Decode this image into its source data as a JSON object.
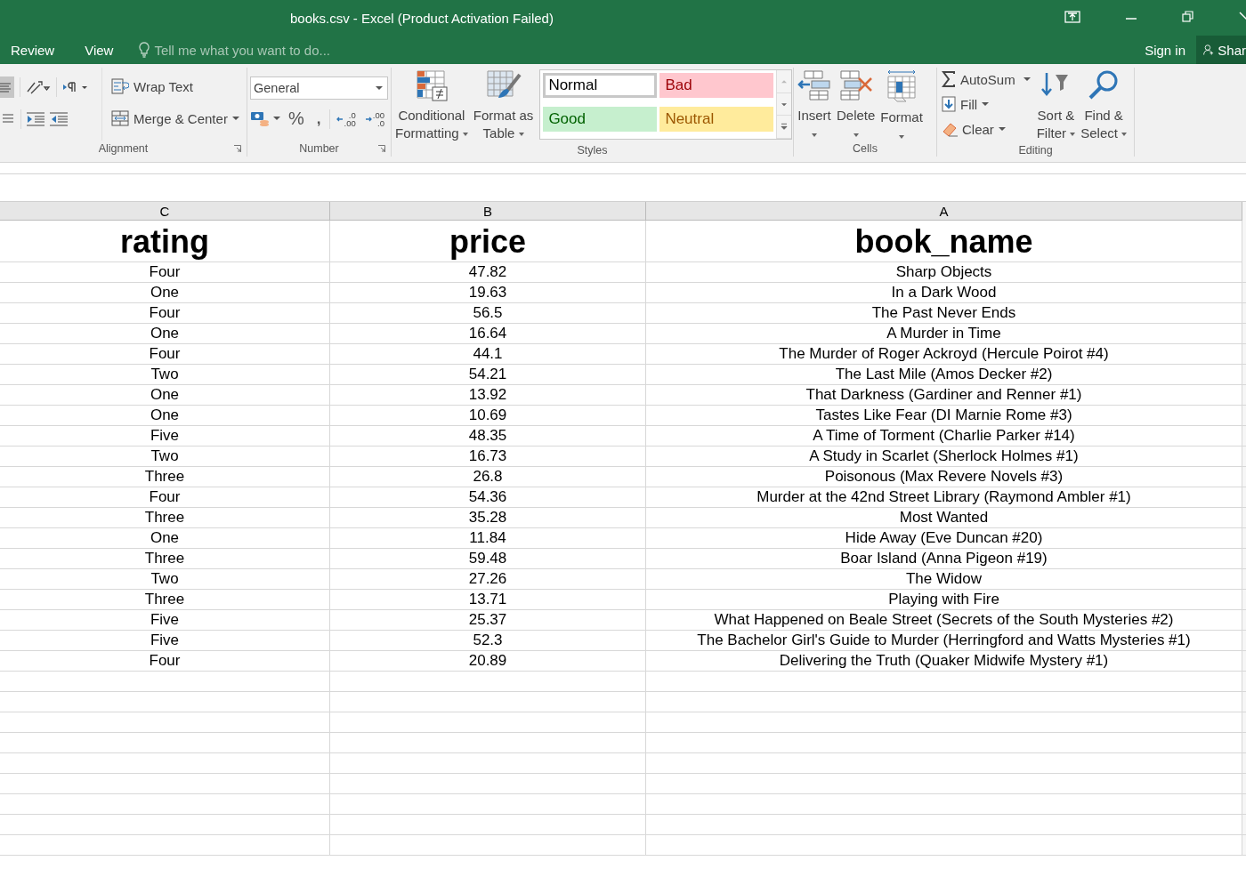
{
  "window": {
    "title": "books.csv - Excel (Product Activation Failed)"
  },
  "tabs": [
    {
      "label": "Review"
    },
    {
      "label": "View"
    }
  ],
  "tell_me": {
    "placeholder": "Tell me what you want to do..."
  },
  "account": {
    "sign_in": "Sign in",
    "share": "Shar"
  },
  "ribbon": {
    "alignment": {
      "label": "Alignment",
      "wrap_text": "Wrap Text",
      "merge": "Merge & Center"
    },
    "number": {
      "label": "Number",
      "format": "General",
      "percent": "%",
      "comma": ",",
      "increase_decimal": [
        ".0",
        ".00"
      ],
      "decrease_decimal": [
        ".00",
        ".0"
      ]
    },
    "styles": {
      "label": "Styles",
      "conditional": [
        "Conditional",
        "Formatting"
      ],
      "format_table": [
        "Format as",
        "Table"
      ],
      "cells": [
        {
          "label": "Normal",
          "kind": "normal",
          "selected": true
        },
        {
          "label": "Bad",
          "kind": "bad",
          "selected": false
        },
        {
          "label": "Good",
          "kind": "good",
          "selected": false
        },
        {
          "label": "Neutral",
          "kind": "neutral",
          "selected": false
        }
      ]
    },
    "cells": {
      "label": "Cells",
      "buttons": [
        {
          "label": "Insert",
          "kind": "insert"
        },
        {
          "label": "Delete",
          "kind": "delete"
        },
        {
          "label": "Format",
          "kind": "format"
        }
      ]
    },
    "editing": {
      "label": "Editing",
      "autosum": "AutoSum",
      "fill": "Fill",
      "clear": "Clear",
      "sort": [
        "Sort &",
        "Filter"
      ],
      "find": [
        "Find &",
        "Select"
      ]
    }
  },
  "sheet": {
    "columns": [
      "C",
      "B",
      "A"
    ],
    "header": [
      "rating",
      "price",
      "book_name"
    ],
    "rows": [
      [
        "Four",
        "47.82",
        "Sharp Objects"
      ],
      [
        "One",
        "19.63",
        "In a Dark Wood"
      ],
      [
        "Four",
        "56.5",
        "The Past Never Ends"
      ],
      [
        "One",
        "16.64",
        "A Murder in Time"
      ],
      [
        "Four",
        "44.1",
        "The Murder of Roger Ackroyd (Hercule Poirot #4)"
      ],
      [
        "Two",
        "54.21",
        "The Last Mile (Amos Decker #2)"
      ],
      [
        "One",
        "13.92",
        "That Darkness (Gardiner and Renner #1)"
      ],
      [
        "One",
        "10.69",
        "Tastes Like Fear (DI Marnie Rome #3)"
      ],
      [
        "Five",
        "48.35",
        "A Time of Torment (Charlie Parker #14)"
      ],
      [
        "Two",
        "16.73",
        "A Study in Scarlet (Sherlock Holmes #1)"
      ],
      [
        "Three",
        "26.8",
        "Poisonous (Max Revere Novels #3)"
      ],
      [
        "Four",
        "54.36",
        "Murder at the 42nd Street Library (Raymond Ambler #1)"
      ],
      [
        "Three",
        "35.28",
        "Most Wanted"
      ],
      [
        "One",
        "11.84",
        "Hide Away (Eve Duncan #20)"
      ],
      [
        "Three",
        "59.48",
        "Boar Island (Anna Pigeon #19)"
      ],
      [
        "Two",
        "27.26",
        "The Widow"
      ],
      [
        "Three",
        "13.71",
        "Playing with Fire"
      ],
      [
        "Five",
        "25.37",
        "What Happened on Beale Street (Secrets of the South Mysteries #2)"
      ],
      [
        "Five",
        "52.3",
        "The Bachelor Girl's Guide to Murder (Herringford and Watts Mysteries #1)"
      ],
      [
        "Four",
        "20.89",
        "Delivering the Truth (Quaker Midwife Mystery #1)"
      ]
    ]
  }
}
